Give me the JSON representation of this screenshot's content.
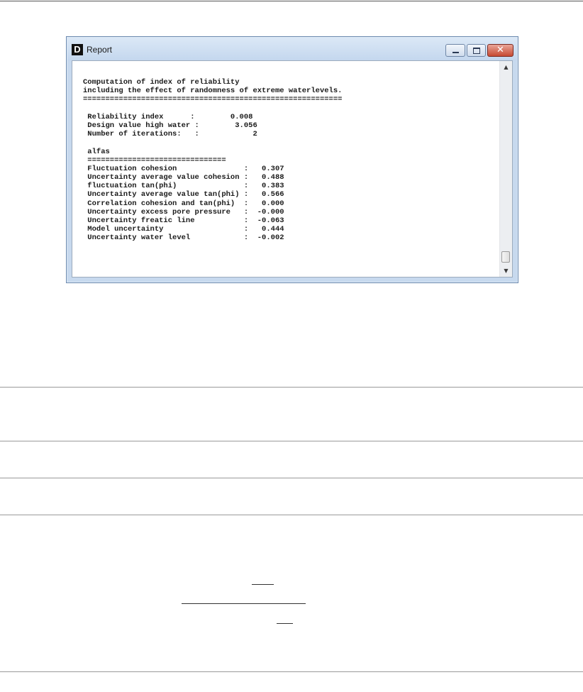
{
  "window": {
    "icon_letter": "D",
    "title": "Report"
  },
  "report": {
    "lines": [
      "Computation of index of reliability",
      "including the effect of randomness of extreme waterlevels.",
      "==========================================================",
      "",
      " Reliability index      :        0.008",
      " Design value high water :        3.056",
      " Number of iterations:   :            2",
      "",
      " alfas",
      " ===============================",
      " Fluctuation cohesion               :   0.307",
      " Uncertainty average value cohesion :   0.488",
      " fluctuation tan(phi)               :   0.383",
      " Uncertainty average value tan(phi) :   0.566",
      " Correlation cohesion and tan(phi)  :   0.000",
      " Uncertainty excess pore pressure   :  -0.000",
      " Uncertainty freatic line           :  -0.063",
      " Model uncertainty                  :   0.444",
      " Uncertainty water level            :  -0.002"
    ]
  },
  "icons": {
    "minimize": "minimize-icon",
    "maximize": "maximize-icon",
    "close": "close-icon",
    "scroll_up": "arrow-up-icon",
    "scroll_down": "arrow-down-icon"
  },
  "colors": {
    "title_bar": "#c7d9ee",
    "close_button": "#c74a33"
  }
}
